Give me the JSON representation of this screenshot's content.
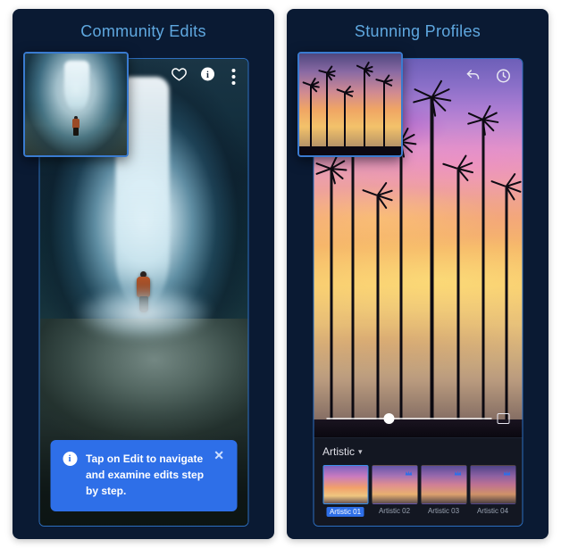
{
  "left": {
    "title": "Community Edits",
    "tip_text": "Tap on Edit to navigate and examine edits step by step.",
    "tip_close": "✕",
    "icons": {
      "heart": "heart-icon",
      "info": "info-icon",
      "kebab": "more-icon"
    }
  },
  "right": {
    "title": "Stunning Profiles",
    "icons": {
      "undo": "undo-icon",
      "clock": "history-icon"
    },
    "profiles_category": "Artistic",
    "profiles": [
      {
        "label": "Artistic 01",
        "selected": true,
        "premium": false
      },
      {
        "label": "Artistic 02",
        "selected": false,
        "premium": true
      },
      {
        "label": "Artistic 03",
        "selected": false,
        "premium": true
      },
      {
        "label": "Artistic 04",
        "selected": false,
        "premium": true
      }
    ]
  }
}
